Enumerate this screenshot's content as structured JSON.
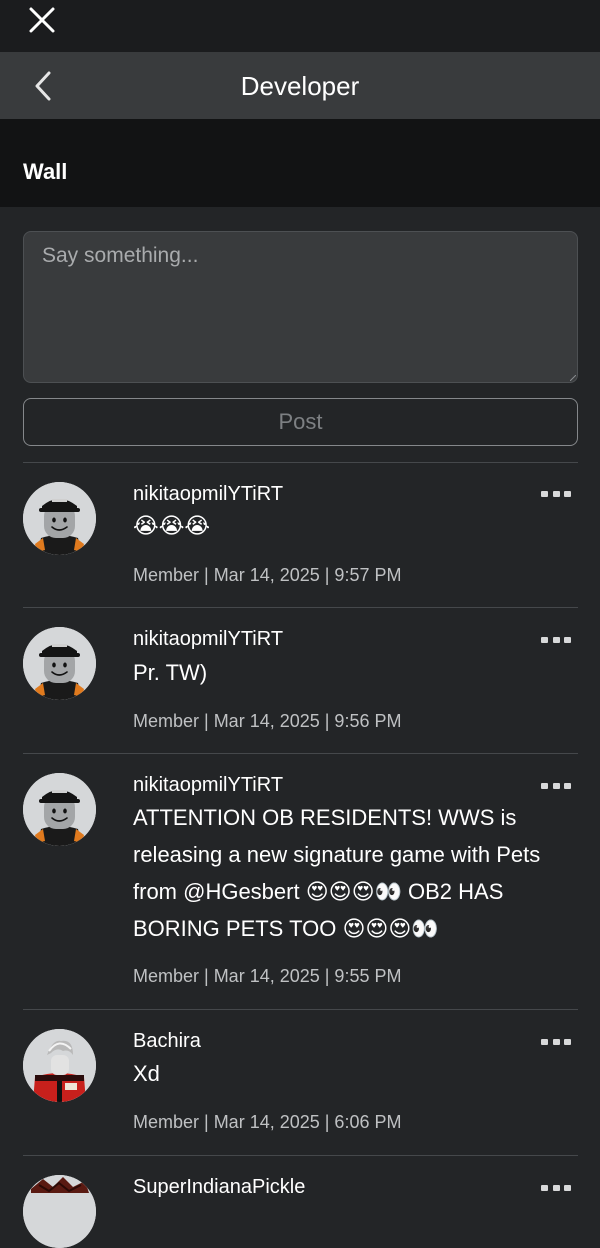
{
  "topbar": {
    "close_icon": "close-icon"
  },
  "navbar": {
    "back_icon": "chevron-left-icon",
    "title": "Developer"
  },
  "wall": {
    "title": "Wall",
    "composer_placeholder": "Say something...",
    "post_label": "Post"
  },
  "posts": [
    {
      "author": "nikitaopmilYTiRT",
      "text": "😭😭😭",
      "meta": "Member | Mar 14, 2025 | 9:57 PM"
    },
    {
      "author": "nikitaopmilYTiRT",
      "text": "Pr. TW)",
      "meta": "Member | Mar 14, 2025 | 9:56 PM"
    },
    {
      "author": "nikitaopmilYTiRT",
      "text": "ATTENTION OB RESIDENTS! WWS is releasing a new signature game with Pets from @HGesbert 😍😍😍👀 OB2 HAS BORING PETS TOO 😍😍😍👀",
      "meta": "Member | Mar 14, 2025 | 9:55 PM"
    },
    {
      "author": "Bachira",
      "text": "Xd",
      "meta": "Member | Mar 14, 2025 | 6:06 PM"
    },
    {
      "author": "SuperIndianaPickle",
      "text": "",
      "meta": ""
    }
  ],
  "colors": {
    "background": "#232527",
    "topbar": "#1b1c1e",
    "navbar": "#393b3d",
    "section_header": "#121314",
    "meta_text": "#bfc1c3"
  }
}
